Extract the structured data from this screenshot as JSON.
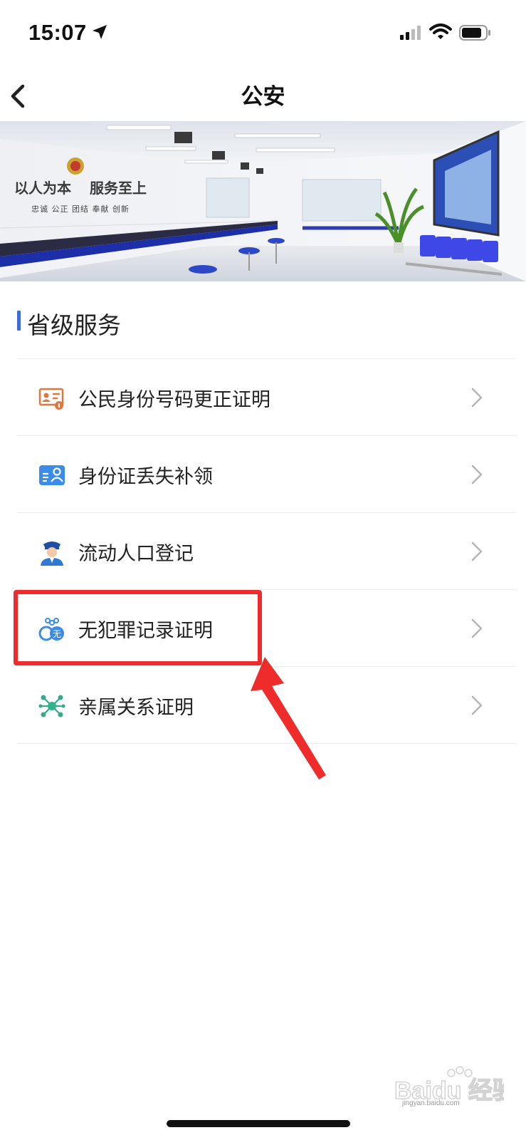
{
  "status_bar": {
    "time": "15:07"
  },
  "header": {
    "title": "公安"
  },
  "banner": {
    "slogan_left": "以人为本",
    "slogan_right": "服务至上",
    "motto": "忠诚 公正 团结 奉献 创新"
  },
  "section": {
    "title": "省级服务"
  },
  "services": [
    {
      "label": "公民身份号码更正证明",
      "icon": "id-card-correction-icon"
    },
    {
      "label": "身份证丢失补领",
      "icon": "id-card-icon"
    },
    {
      "label": "流动人口登记",
      "icon": "police-officer-icon"
    },
    {
      "label": "无犯罪记录证明",
      "icon": "handcuffs-icon"
    },
    {
      "label": "亲属关系证明",
      "icon": "relationship-network-icon"
    }
  ],
  "colors": {
    "accent": "#3f6ad8",
    "annotation_red": "#ee2c2c",
    "divider": "#ececec",
    "chevron": "#b5b5b5"
  },
  "watermark": {
    "brand": "Baidu 经验",
    "url": "jingyan.baidu.com"
  }
}
